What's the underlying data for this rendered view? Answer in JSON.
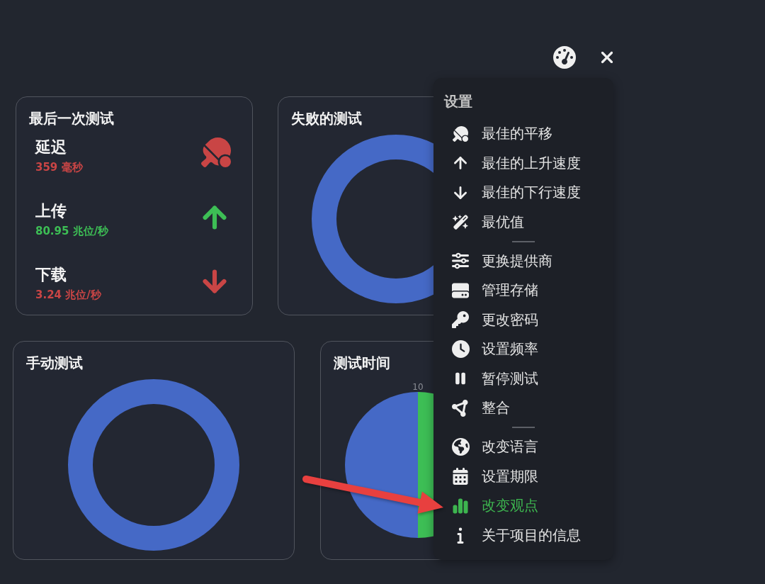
{
  "last_test": {
    "title": "最后一次测试",
    "metrics": [
      {
        "label": "延迟",
        "value": "359 毫秒",
        "color": "#c94545"
      },
      {
        "label": "上传",
        "value": "80.95 兆位/秒",
        "color": "#3dbe55"
      },
      {
        "label": "下载",
        "value": "3.24 兆位/秒",
        "color": "#c94545"
      }
    ]
  },
  "failed_tests": {
    "title": "失败的测试"
  },
  "manual_tests": {
    "title": "手动测试"
  },
  "test_time": {
    "title": "测试时间",
    "pie_label": "10"
  },
  "settings_menu": {
    "title": "设置",
    "groups": [
      {
        "items": [
          {
            "label": "最佳的平移",
            "selected": false
          },
          {
            "label": "最佳的上升速度",
            "selected": false
          },
          {
            "label": "最佳的下行速度",
            "selected": false
          },
          {
            "label": "最优值",
            "selected": false
          }
        ]
      },
      {
        "items": [
          {
            "label": "更换提供商",
            "selected": false
          },
          {
            "label": "管理存储",
            "selected": false
          },
          {
            "label": "更改密码",
            "selected": false
          },
          {
            "label": "设置频率",
            "selected": false
          },
          {
            "label": "暂停测试",
            "selected": false
          },
          {
            "label": "整合",
            "selected": false
          }
        ]
      },
      {
        "items": [
          {
            "label": "改变语言",
            "selected": false
          },
          {
            "label": "设置期限",
            "selected": false
          },
          {
            "label": "改变观点",
            "selected": true
          },
          {
            "label": "关于项目的信息",
            "selected": false
          }
        ]
      }
    ]
  }
}
